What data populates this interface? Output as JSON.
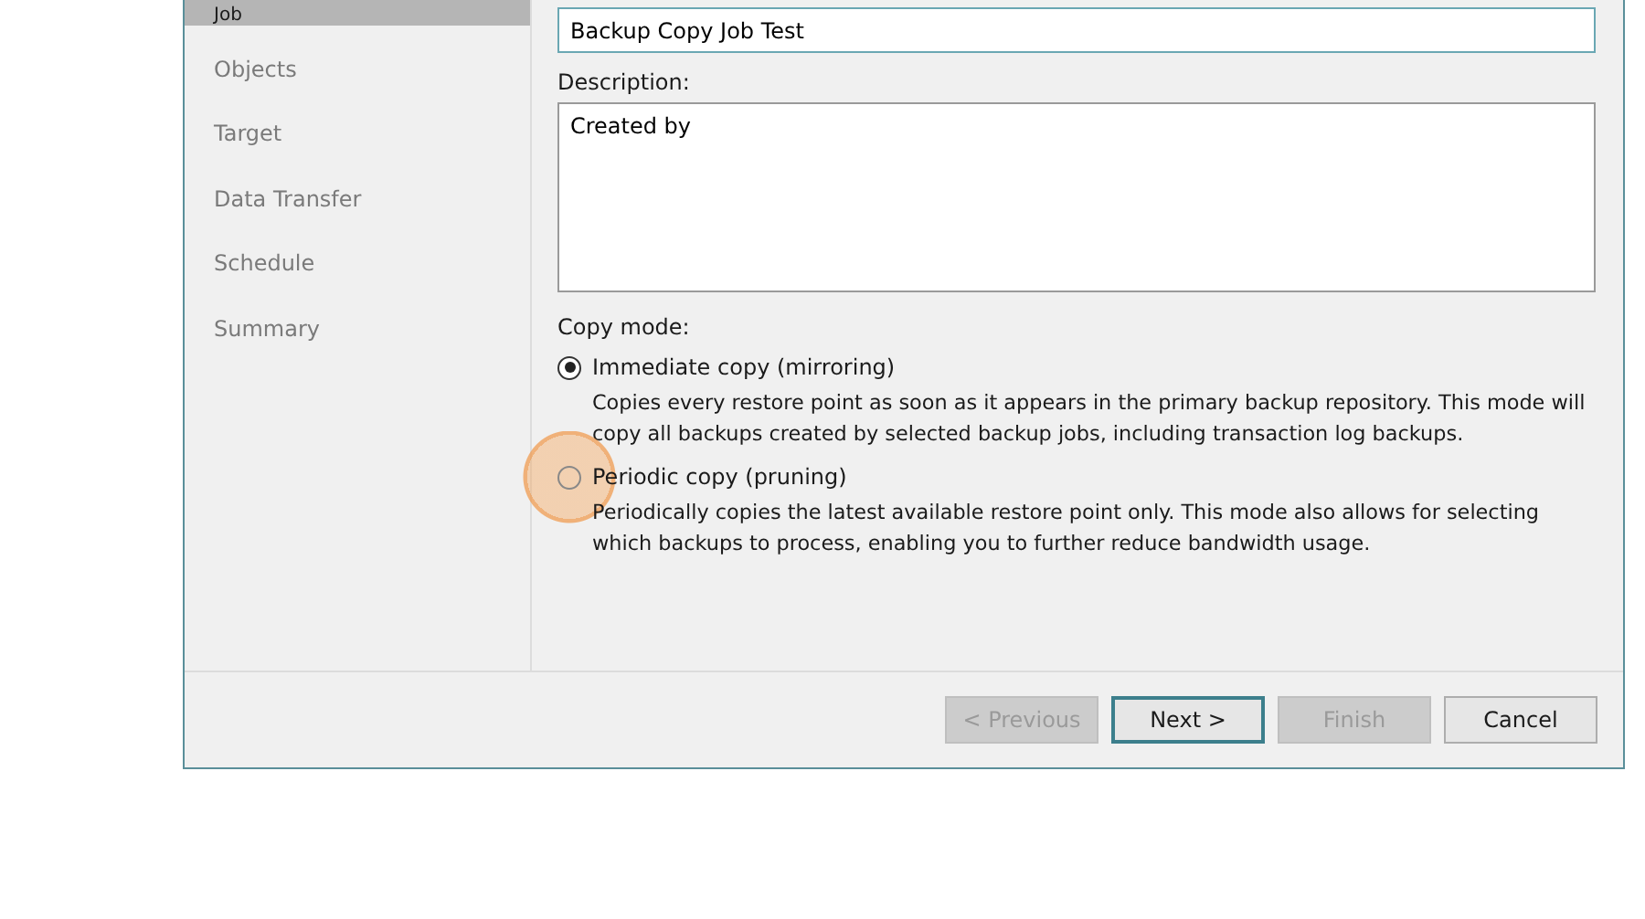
{
  "sidebar": {
    "items": [
      {
        "label": "Job",
        "selected": true
      },
      {
        "label": "Objects",
        "selected": false
      },
      {
        "label": "Target",
        "selected": false
      },
      {
        "label": "Data Transfer",
        "selected": false
      },
      {
        "label": "Schedule",
        "selected": false
      },
      {
        "label": "Summary",
        "selected": false
      }
    ]
  },
  "name_field": {
    "value": "Backup Copy Job Test"
  },
  "description": {
    "label": "Description:",
    "value": "Created by"
  },
  "copy_mode": {
    "label": "Copy mode:",
    "options": [
      {
        "label": "Immediate copy (mirroring)",
        "selected": true,
        "description": "Copies every restore point as soon as it appears in the primary backup repository. This mode will copy all backups created by selected backup jobs, including transaction log backups.",
        "highlighted": false
      },
      {
        "label": "Periodic copy (pruning)",
        "selected": false,
        "description": "Periodically copies the latest available restore point only. This mode also allows for selecting which backups to process, enabling you to further reduce bandwidth usage.",
        "highlighted": true
      }
    ]
  },
  "buttons": [
    {
      "label": "< Previous",
      "disabled": true,
      "focused": false
    },
    {
      "label": "Next >",
      "disabled": false,
      "focused": true
    },
    {
      "label": "Finish",
      "disabled": true,
      "focused": false
    },
    {
      "label": "Cancel",
      "disabled": false,
      "focused": false
    }
  ]
}
